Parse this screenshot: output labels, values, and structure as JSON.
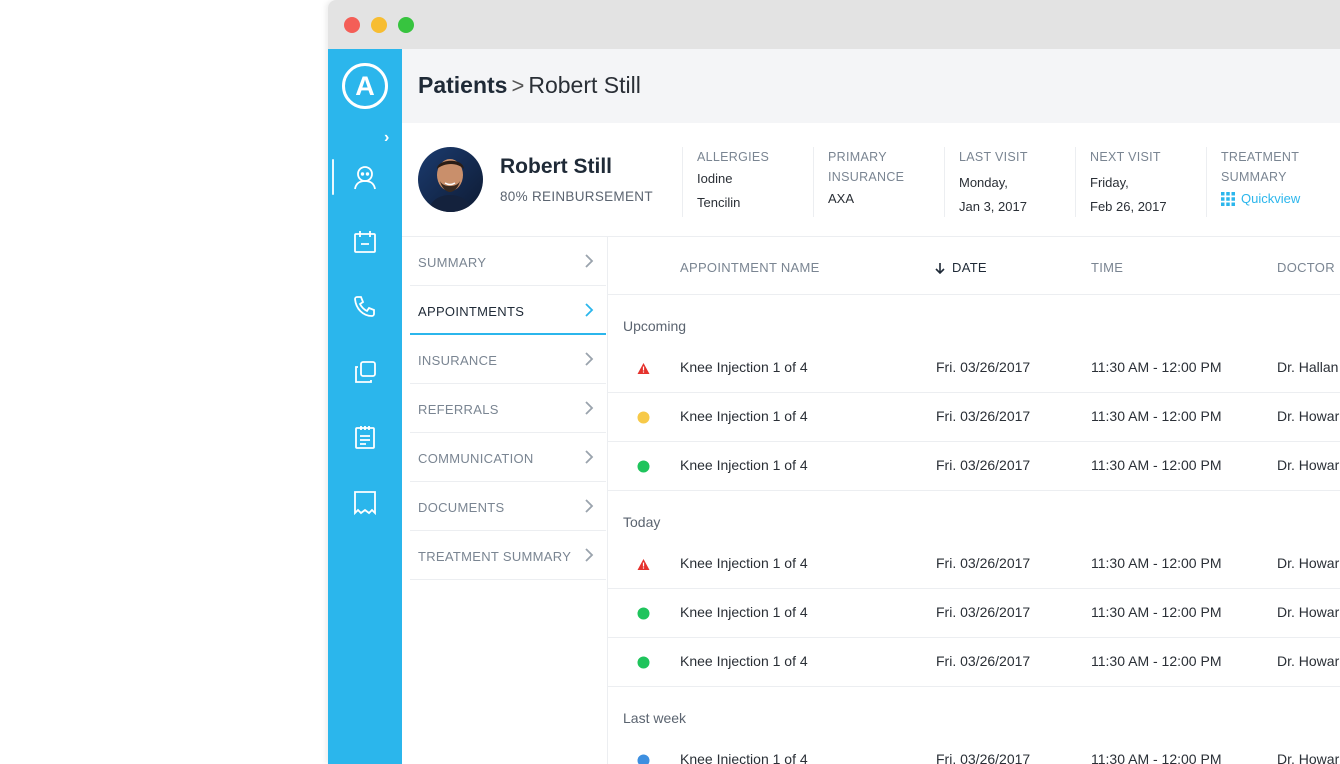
{
  "window": {
    "controls": [
      "close",
      "minimize",
      "maximize"
    ]
  },
  "sidebar": {
    "logo": "A",
    "icons": [
      "patient-icon",
      "calendar-icon",
      "phone-icon",
      "copy-icon",
      "notes-icon",
      "receipt-icon"
    ],
    "accent": "#2bb6ec"
  },
  "breadcrumb": {
    "root": "Patients",
    "separator": ">",
    "current": "Robert Still"
  },
  "patient": {
    "name": "Robert Still",
    "reimbursement": "80% REINBURSEMENT",
    "allergies": {
      "label": "ALLERGIES",
      "values": [
        "Iodine",
        "Tencilin"
      ]
    },
    "insurance": {
      "label_line1": "PRIMARY",
      "label_line2": "INSURANCE",
      "value": "AXA"
    },
    "last_visit": {
      "label": "LAST VISIT",
      "line1": "Monday,",
      "line2": "Jan 3, 2017"
    },
    "next_visit": {
      "label": "NEXT VISIT",
      "line1": "Friday,",
      "line2": "Feb 26, 2017"
    },
    "treatment": {
      "label_line1": "TREATMENT",
      "label_line2": "SUMMARY",
      "link": "Quickview"
    }
  },
  "subnav": {
    "items": [
      "SUMMARY",
      "APPOINTMENTS",
      "INSURANCE",
      "REFERRALS",
      "COMMUNICATION",
      "DOCUMENTS",
      "TREATMENT SUMMARY"
    ],
    "active": "APPOINTMENTS"
  },
  "table": {
    "columns": {
      "name": "APPOINTMENT NAME",
      "date": "DATE",
      "time": "TIME",
      "doctor": "DOCTOR"
    },
    "sort_column": "DATE",
    "groups": [
      {
        "title": "Upcoming",
        "rows": [
          {
            "status": "warning",
            "name": "Knee Injection 1 of 4",
            "date": "Fri. 03/26/2017",
            "time": "11:30 AM - 12:00 PM",
            "doctor": "Dr. Hallan"
          },
          {
            "status": "pending",
            "name": "Knee Injection 1 of 4",
            "date": "Fri. 03/26/2017",
            "time": "11:30 AM - 12:00 PM",
            "doctor": "Dr. Howar"
          },
          {
            "status": "confirmed",
            "name": "Knee Injection 1 of 4",
            "date": "Fri. 03/26/2017",
            "time": "11:30 AM - 12:00 PM",
            "doctor": "Dr. Howar"
          }
        ]
      },
      {
        "title": "Today",
        "rows": [
          {
            "status": "warning",
            "name": "Knee Injection 1 of 4",
            "date": "Fri. 03/26/2017",
            "time": "11:30 AM - 12:00 PM",
            "doctor": "Dr. Howar"
          },
          {
            "status": "confirmed",
            "name": "Knee Injection 1 of 4",
            "date": "Fri. 03/26/2017",
            "time": "11:30 AM - 12:00 PM",
            "doctor": "Dr. Howar"
          },
          {
            "status": "confirmed",
            "name": "Knee Injection 1 of 4",
            "date": "Fri. 03/26/2017",
            "time": "11:30 AM - 12:00 PM",
            "doctor": "Dr. Howar"
          }
        ]
      },
      {
        "title": "Last week",
        "rows": [
          {
            "status": "completed",
            "name": "Knee Injection 1 of 4",
            "date": "Fri. 03/26/2017",
            "time": "11:30 AM - 12:00 PM",
            "doctor": "Dr. Howar"
          }
        ]
      }
    ],
    "status_colors": {
      "warning": "#e5322d",
      "pending": "#f7c948",
      "confirmed": "#1fc45c",
      "completed": "#3d8fe0"
    }
  }
}
